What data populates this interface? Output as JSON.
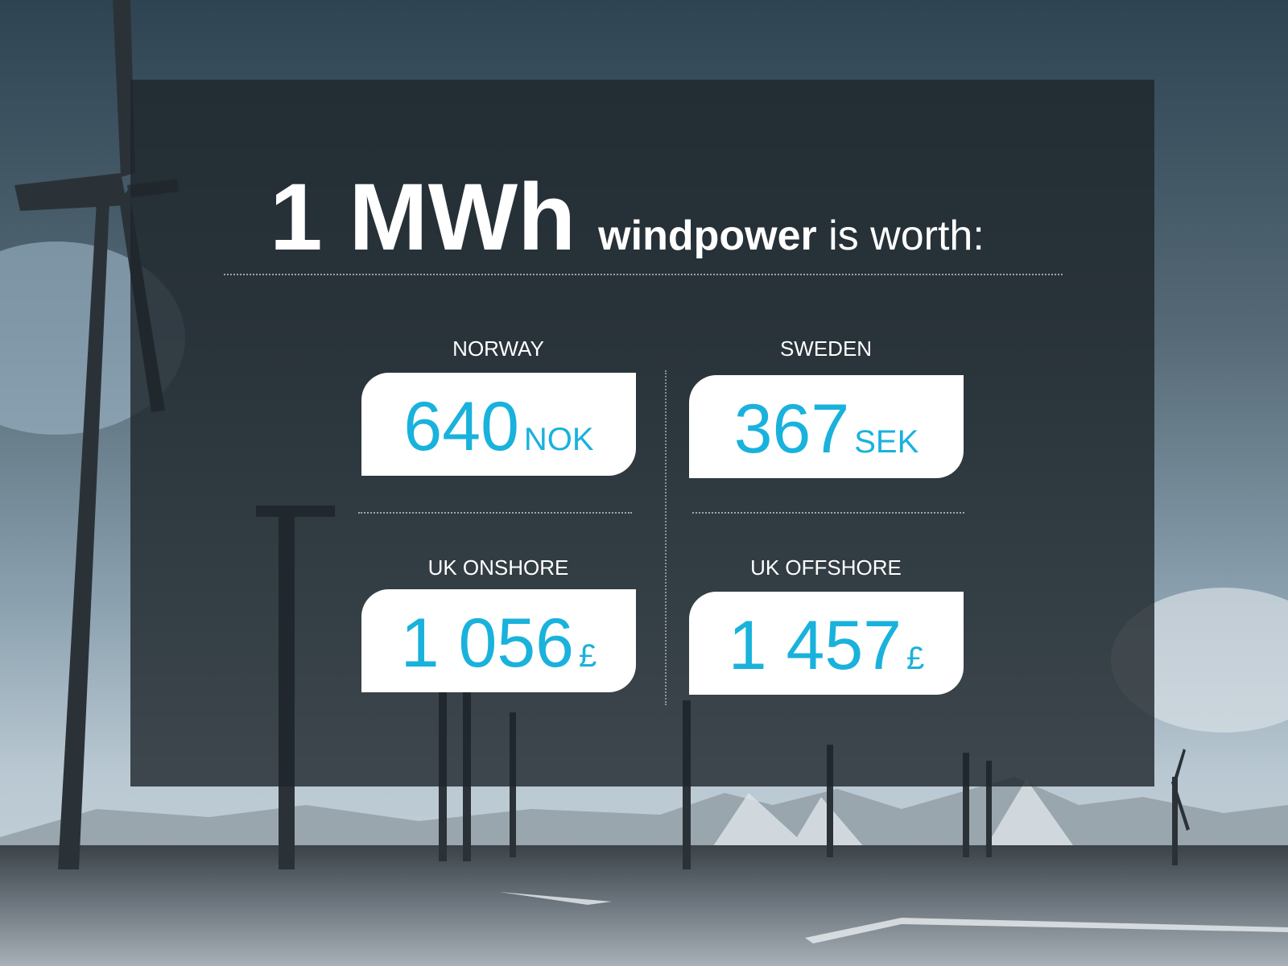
{
  "headline": {
    "amount": "1 MWh",
    "subject_bold": "windpower",
    "subject_rest": " is worth:"
  },
  "prices": [
    {
      "region": "NORWAY",
      "value": "640",
      "currency": "NOK"
    },
    {
      "region": "SWEDEN",
      "value": "367",
      "currency": "SEK"
    },
    {
      "region": "UK ONSHORE",
      "value": "1 056",
      "currency": "£"
    },
    {
      "region": "UK OFFSHORE",
      "value": "1 457",
      "currency": "£"
    }
  ],
  "colors": {
    "accent": "#19b2dc",
    "panel": "#1e262a",
    "card": "#ffffff"
  },
  "background": "photo of a wind farm with turbines in a snowy landscape under a stormy sky"
}
